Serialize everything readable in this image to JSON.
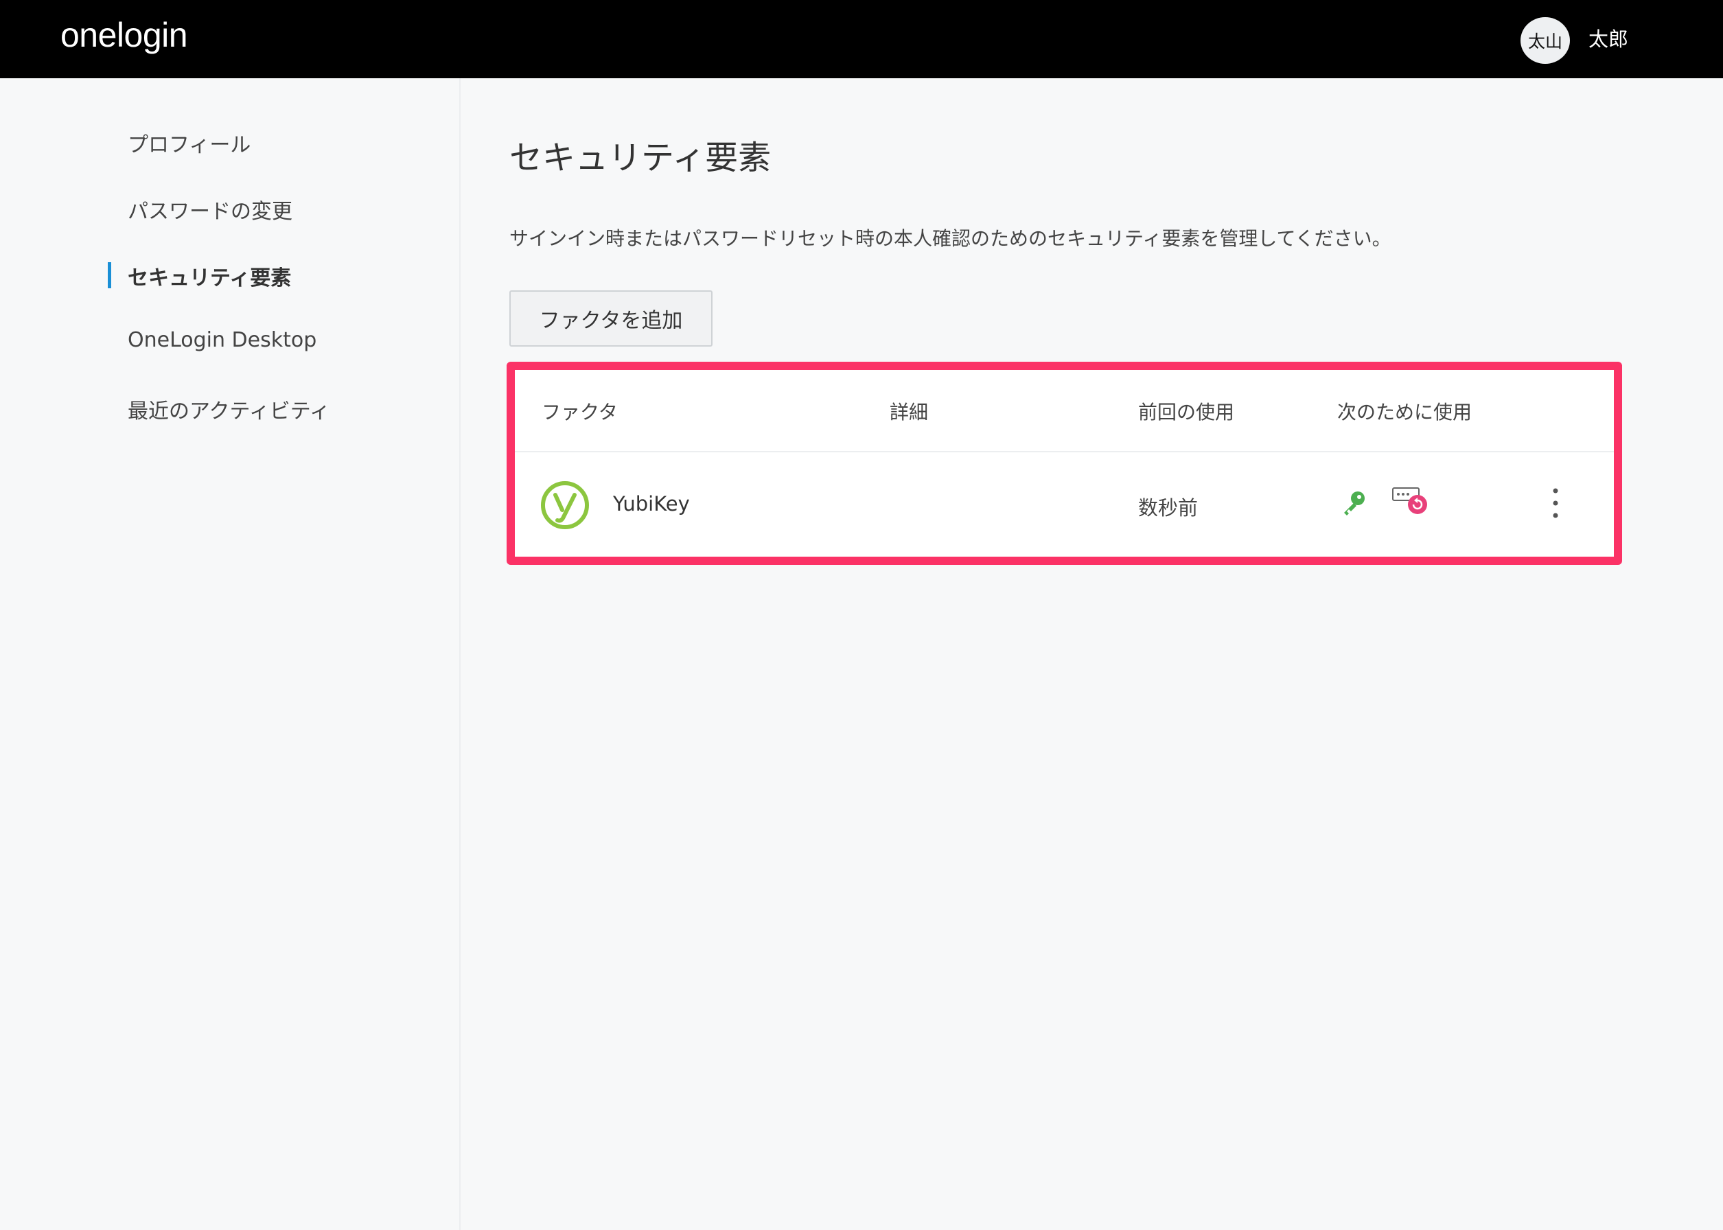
{
  "header": {
    "logo": "onelogin",
    "avatar_initials": "太山",
    "user_name": "太郎"
  },
  "sidebar": {
    "items": [
      {
        "label": "プロフィール"
      },
      {
        "label": "パスワードの変更"
      },
      {
        "label": "セキュリティ要素",
        "active": true
      },
      {
        "label": "OneLogin Desktop"
      },
      {
        "label": "最近のアクティビティ"
      }
    ]
  },
  "main": {
    "title": "セキュリティ要素",
    "description": "サインイン時またはパスワードリセット時の本人確認のためのセキュリティ要素を管理してください。",
    "add_button": "ファクタを追加",
    "table": {
      "headers": {
        "factor": "ファクタ",
        "details": "詳細",
        "last_used": "前回の使用",
        "used_for": "次のために使用"
      },
      "rows": [
        {
          "factor": "YubiKey",
          "details": "",
          "last_used": "数秒前",
          "used_for_icons": [
            "key-icon",
            "password-reset-icon"
          ]
        }
      ]
    }
  },
  "colors": {
    "topbar": "#000000",
    "accent_marker": "#1a8fd6",
    "highlight_border": "#fb3266",
    "yubikey_green": "#8cc63f",
    "key_green": "#4caf50",
    "reset_pink": "#e8407a"
  }
}
